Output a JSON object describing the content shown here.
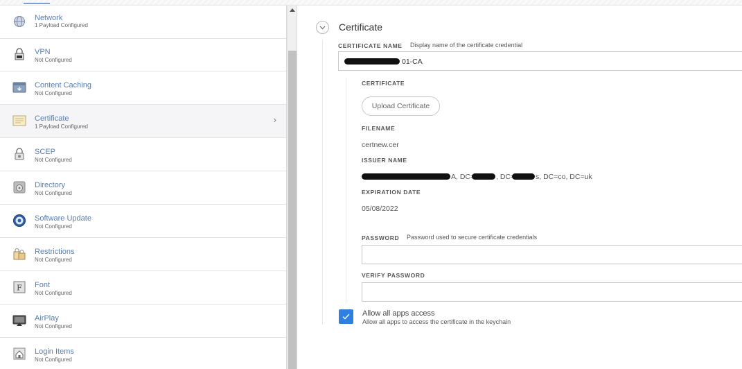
{
  "sidebar": {
    "items": [
      {
        "title": "Network",
        "subtitle": "1 Payload Configured",
        "icon": "network-globe-icon"
      },
      {
        "title": "VPN",
        "subtitle": "Not Configured",
        "icon": "vpn-lock-icon"
      },
      {
        "title": "Content Caching",
        "subtitle": "Not Configured",
        "icon": "content-caching-icon"
      },
      {
        "title": "Certificate",
        "subtitle": "1 Payload Configured",
        "icon": "certificate-icon"
      },
      {
        "title": "SCEP",
        "subtitle": "Not Configured",
        "icon": "scep-lock-icon"
      },
      {
        "title": "Directory",
        "subtitle": "Not Configured",
        "icon": "directory-icon"
      },
      {
        "title": "Software Update",
        "subtitle": "Not Configured",
        "icon": "software-update-icon"
      },
      {
        "title": "Restrictions",
        "subtitle": "Not Configured",
        "icon": "restrictions-icon"
      },
      {
        "title": "Font",
        "subtitle": "Not Configured",
        "icon": "font-icon"
      },
      {
        "title": "AirPlay",
        "subtitle": "Not Configured",
        "icon": "airplay-icon"
      },
      {
        "title": "Login Items",
        "subtitle": "Not Configured",
        "icon": "login-items-icon"
      }
    ],
    "selected_index": 3
  },
  "main": {
    "section_title": "Certificate",
    "certificate_name": {
      "label": "CERTIFICATE NAME",
      "hint": "Display name of the certificate credential",
      "value_visible": "01-CA"
    },
    "certificate": {
      "label": "CERTIFICATE",
      "upload_button": "Upload Certificate"
    },
    "filename": {
      "label": "FILENAME",
      "value": "certnew.cer"
    },
    "issuer": {
      "label": "ISSUER NAME",
      "value_visible_1": "A, DC=",
      "value_visible_2": ", DC=",
      "value_visible_3": "s, DC=co, DC=uk"
    },
    "expiration": {
      "label": "EXPIRATION DATE",
      "value": "05/08/2022"
    },
    "password": {
      "label": "PASSWORD",
      "hint": "Password used to secure certificate credentials",
      "value": ""
    },
    "verify_password": {
      "label": "VERIFY PASSWORD",
      "value": ""
    },
    "allow_apps": {
      "label": "Allow all apps access",
      "description": "Allow all apps to access the certificate in the keychain",
      "checked": true
    }
  },
  "colors": {
    "sidebar_title": "#5a7db0",
    "checkbox": "#2f7fe0",
    "selected_row": "#f5f5f7"
  }
}
